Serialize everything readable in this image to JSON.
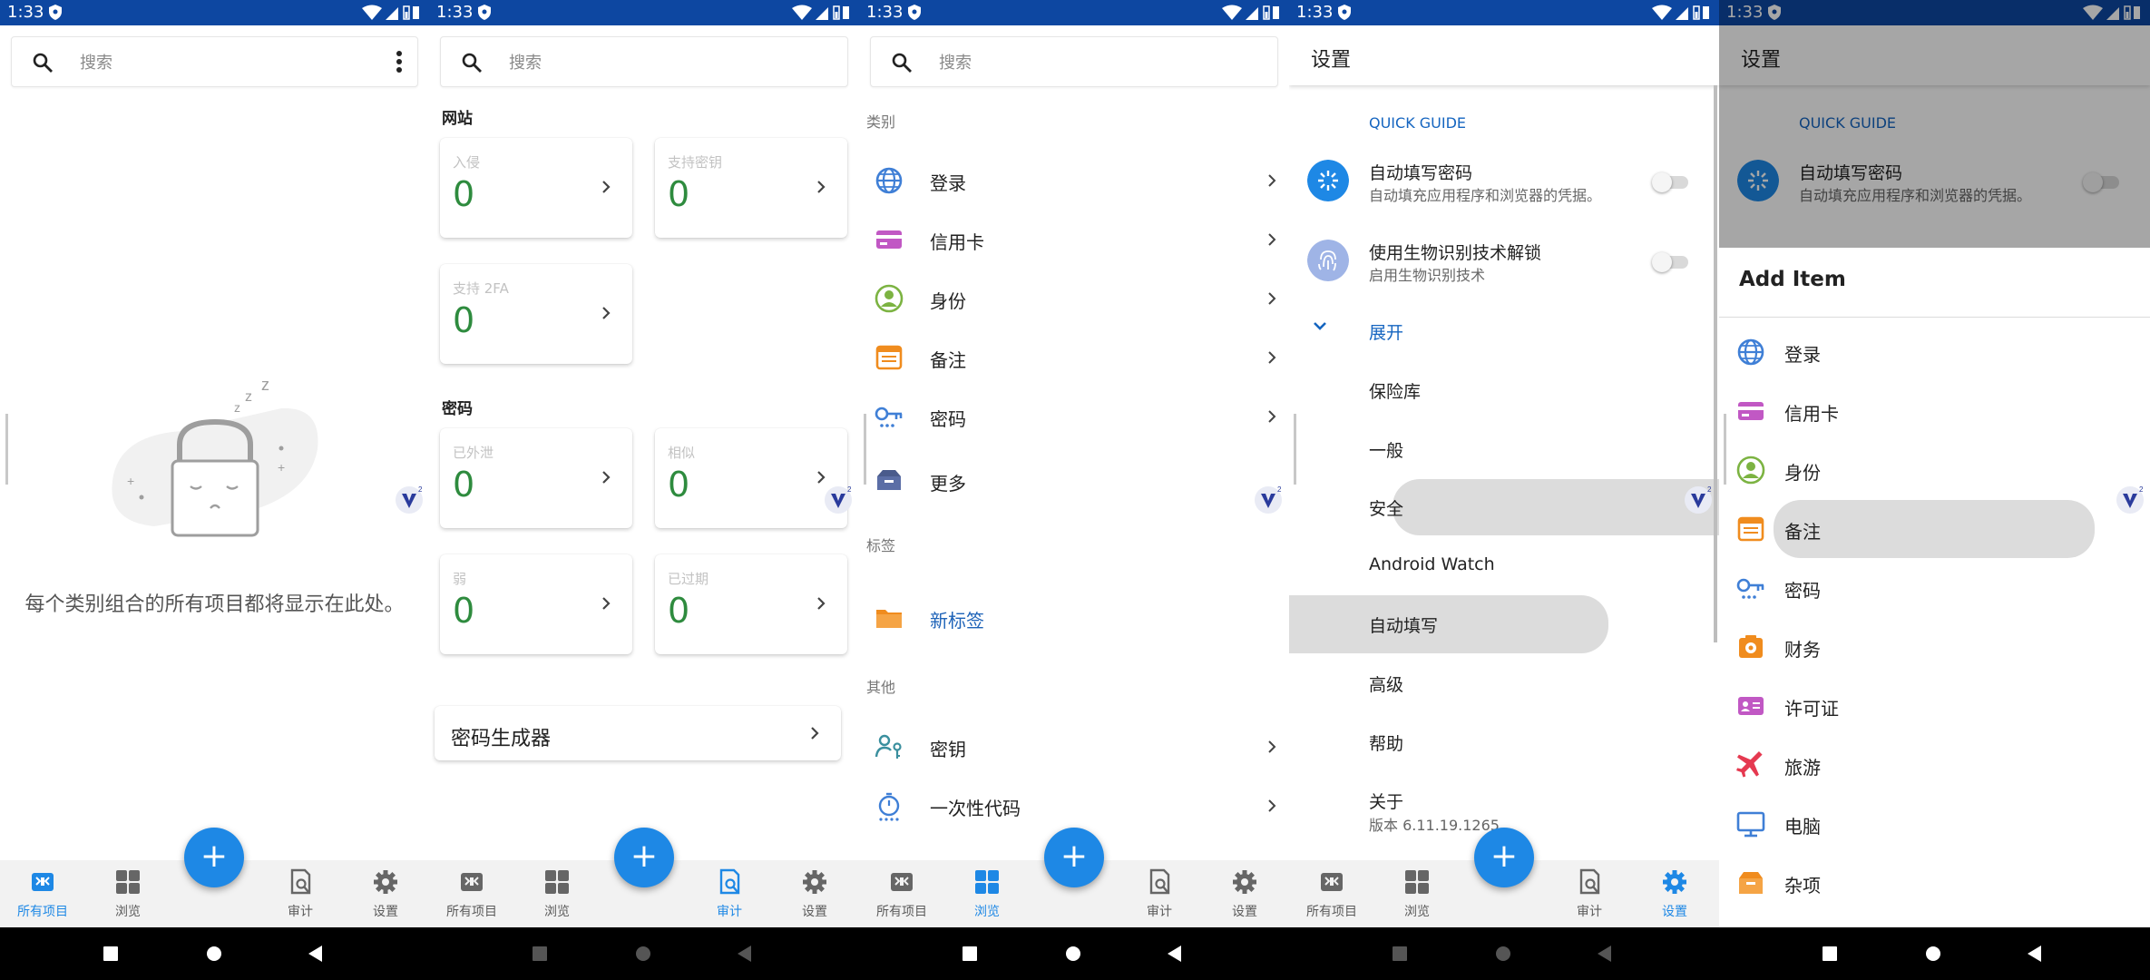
{
  "status_bar": {
    "time": "1:33"
  },
  "panel1": {
    "search_placeholder": "搜索",
    "empty_message": "每个类别组合的所有项目都将显示在此处。"
  },
  "panel2": {
    "search_placeholder": "搜索",
    "section_websites": "网站",
    "website_cards": [
      {
        "label": "入侵",
        "value": "0"
      },
      {
        "label": "支持密钥",
        "value": "0"
      },
      {
        "label": "支持 2FA",
        "value": "0"
      }
    ],
    "section_passwords": "密码",
    "password_cards": [
      {
        "label": "已外泄",
        "value": "0"
      },
      {
        "label": "相似",
        "value": "0"
      },
      {
        "label": "弱",
        "value": "0"
      },
      {
        "label": "已过期",
        "value": "0"
      }
    ],
    "generator_label": "密码生成器"
  },
  "panel3": {
    "search_placeholder": "搜索",
    "header_categories": "类别",
    "categories": [
      {
        "label": "登录",
        "icon": "globe-icon"
      },
      {
        "label": "信用卡",
        "icon": "credit-card-icon"
      },
      {
        "label": "身份",
        "icon": "identity-icon"
      },
      {
        "label": "备注",
        "icon": "note-icon"
      },
      {
        "label": "密码",
        "icon": "key-icon"
      },
      {
        "label": "更多",
        "icon": "more-box-icon"
      }
    ],
    "header_tags": "标签",
    "new_tag_label": "新标签",
    "header_other": "其他",
    "others": [
      {
        "label": "密钥",
        "icon": "passkey-icon"
      },
      {
        "label": "一次性代码",
        "icon": "stopwatch-icon"
      }
    ]
  },
  "panel4": {
    "title": "设置",
    "quick_guide": "QUICK GUIDE",
    "autofill_title": "自动填写密码",
    "autofill_subtitle": "自动填充应用程序和浏览器的凭据。",
    "biometric_title": "使用生物识别技术解锁",
    "biometric_subtitle": "启用生物识别技术",
    "expand_label": "展开",
    "menu": [
      "保险库",
      "一般",
      "安全",
      "Android Watch",
      "自动填写",
      "高级",
      "帮助",
      "关于"
    ],
    "version": "版本 6.11.19.1265"
  },
  "panel5": {
    "title": "设置",
    "quick_guide": "QUICK GUIDE",
    "autofill_title": "自动填写密码",
    "autofill_subtitle": "自动填充应用程序和浏览器的凭据。",
    "sheet_title": "Add Item",
    "items": [
      {
        "label": "登录",
        "icon": "globe-icon"
      },
      {
        "label": "信用卡",
        "icon": "credit-card-icon"
      },
      {
        "label": "身份",
        "icon": "identity-icon"
      },
      {
        "label": "备注",
        "icon": "note-icon"
      },
      {
        "label": "密码",
        "icon": "key-icon"
      },
      {
        "label": "财务",
        "icon": "safe-icon"
      },
      {
        "label": "许可证",
        "icon": "license-icon"
      },
      {
        "label": "旅游",
        "icon": "airplane-icon"
      },
      {
        "label": "电脑",
        "icon": "monitor-icon"
      },
      {
        "label": "杂项",
        "icon": "box-icon"
      }
    ]
  },
  "bottom_nav": [
    {
      "label": "所有项目",
      "icon": "all-items-icon"
    },
    {
      "label": "浏览",
      "icon": "grid-icon"
    },
    {
      "label": "审计",
      "icon": "audit-icon"
    },
    {
      "label": "设置",
      "icon": "gear-icon"
    }
  ],
  "active_tabs": {
    "panel1": "所有项目",
    "panel2": "审计",
    "panel3": "浏览",
    "panel4": "设置"
  },
  "colors": {
    "accent": "#1e88e5",
    "status_bar": "#0d47a1",
    "value_green": "#2e8b3e",
    "note_orange": "#f08c1e",
    "card_magenta": "#c158c4",
    "identity_green": "#7cb342"
  }
}
